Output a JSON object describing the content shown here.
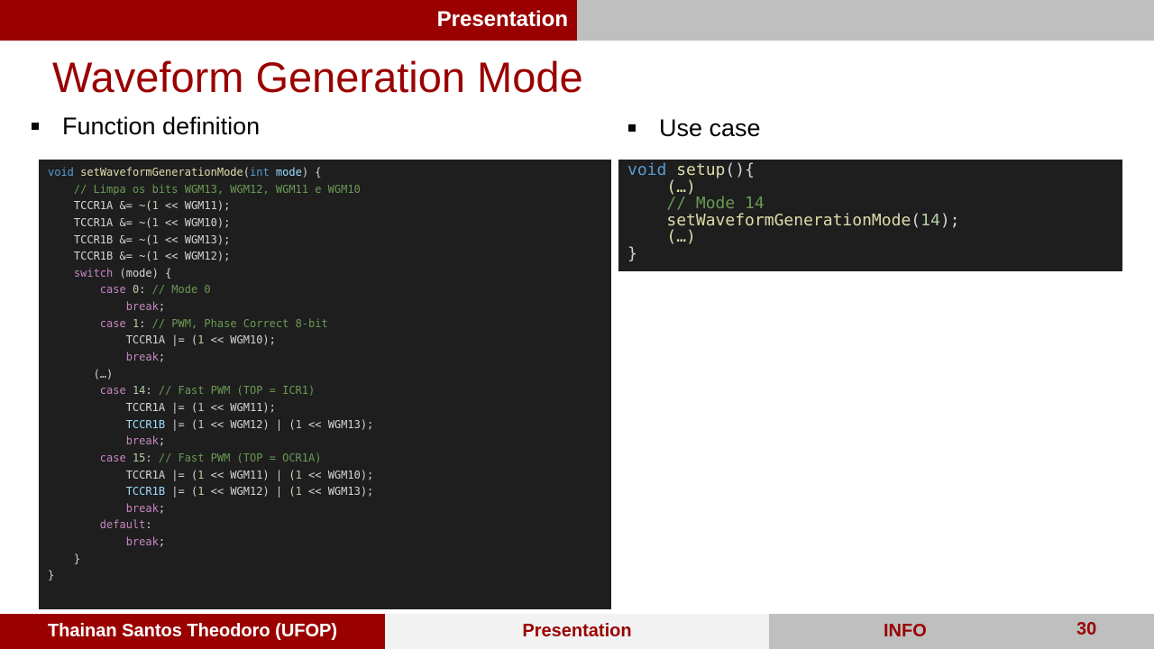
{
  "header": {
    "section_label": "Presentation"
  },
  "slide": {
    "title": "Waveform Generation Mode",
    "left_bullet": "Function definition",
    "right_bullet": "Use case"
  },
  "code_left": [
    [
      [
        "kw",
        "void"
      ],
      [
        "id",
        " "
      ],
      [
        "fn",
        "setWaveformGenerationMode"
      ],
      [
        "id",
        "("
      ],
      [
        "kw",
        "int"
      ],
      [
        "id",
        " "
      ],
      [
        "var",
        "mode"
      ],
      [
        "id",
        ") {"
      ]
    ],
    [
      [
        "id",
        "    "
      ],
      [
        "cm",
        "// Limpa os bits WGM13, WGM12, WGM11 e WGM10"
      ]
    ],
    [
      [
        "id",
        "    TCCR1A &= ~("
      ],
      [
        "num",
        "1"
      ],
      [
        "id",
        " << WGM11);"
      ]
    ],
    [
      [
        "id",
        "    TCCR1A &= ~("
      ],
      [
        "num",
        "1"
      ],
      [
        "id",
        " << WGM10);"
      ]
    ],
    [
      [
        "id",
        "    TCCR1B &= ~("
      ],
      [
        "num",
        "1"
      ],
      [
        "id",
        " << WGM13);"
      ]
    ],
    [
      [
        "id",
        "    TCCR1B &= ~("
      ],
      [
        "num",
        "1"
      ],
      [
        "id",
        " << WGM12);"
      ]
    ],
    [
      [
        "id",
        "    "
      ],
      [
        "ctl",
        "switch"
      ],
      [
        "id",
        " (mode) {"
      ]
    ],
    [
      [
        "id",
        "        "
      ],
      [
        "ctl",
        "case"
      ],
      [
        "id",
        " "
      ],
      [
        "num",
        "0"
      ],
      [
        "id",
        ": "
      ],
      [
        "cm",
        "// Mode 0"
      ]
    ],
    [
      [
        "id",
        "            "
      ],
      [
        "ctl",
        "break"
      ],
      [
        "id",
        ";"
      ]
    ],
    [
      [
        "id",
        "        "
      ],
      [
        "ctl",
        "case"
      ],
      [
        "id",
        " "
      ],
      [
        "num",
        "1"
      ],
      [
        "id",
        ": "
      ],
      [
        "cm",
        "// PWM, Phase Correct 8-bit"
      ]
    ],
    [
      [
        "id",
        "            TCCR1A |= ("
      ],
      [
        "num",
        "1"
      ],
      [
        "id",
        " << WGM10);"
      ]
    ],
    [
      [
        "id",
        "            "
      ],
      [
        "ctl",
        "break"
      ],
      [
        "id",
        ";"
      ]
    ],
    [
      [
        "id",
        "       (…)"
      ]
    ],
    [
      [
        "id",
        "        "
      ],
      [
        "ctl",
        "case"
      ],
      [
        "id",
        " "
      ],
      [
        "num",
        "14"
      ],
      [
        "id",
        ": "
      ],
      [
        "cm",
        "// Fast PWM (TOP = ICR1)"
      ]
    ],
    [
      [
        "id",
        "            TCCR1A |= ("
      ],
      [
        "num",
        "1"
      ],
      [
        "id",
        " << WGM11);"
      ]
    ],
    [
      [
        "id",
        "            "
      ],
      [
        "var",
        "TCCR1B"
      ],
      [
        "id",
        " |= ("
      ],
      [
        "num",
        "1"
      ],
      [
        "id",
        " << WGM12) | ("
      ],
      [
        "num",
        "1"
      ],
      [
        "id",
        " << WGM13);"
      ]
    ],
    [
      [
        "id",
        "            "
      ],
      [
        "ctl",
        "break"
      ],
      [
        "id",
        ";"
      ]
    ],
    [
      [
        "id",
        "        "
      ],
      [
        "ctl",
        "case"
      ],
      [
        "id",
        " "
      ],
      [
        "num",
        "15"
      ],
      [
        "id",
        ": "
      ],
      [
        "cm",
        "// Fast PWM (TOP = OCR1A)"
      ]
    ],
    [
      [
        "id",
        "            TCCR1A |= ("
      ],
      [
        "num",
        "1"
      ],
      [
        "id",
        " << WGM11) | ("
      ],
      [
        "num",
        "1"
      ],
      [
        "id",
        " << WGM10);"
      ]
    ],
    [
      [
        "id",
        "            "
      ],
      [
        "var",
        "TCCR1B"
      ],
      [
        "id",
        " |= ("
      ],
      [
        "num",
        "1"
      ],
      [
        "id",
        " << WGM12) | ("
      ],
      [
        "num",
        "1"
      ],
      [
        "id",
        " << WGM13);"
      ]
    ],
    [
      [
        "id",
        "            "
      ],
      [
        "ctl",
        "break"
      ],
      [
        "id",
        ";"
      ]
    ],
    [
      [
        "id",
        "        "
      ],
      [
        "ctl",
        "default"
      ],
      [
        "id",
        ":"
      ]
    ],
    [
      [
        "id",
        "            "
      ],
      [
        "ctl",
        "break"
      ],
      [
        "id",
        ";"
      ]
    ],
    [
      [
        "id",
        "    }"
      ]
    ],
    [
      [
        "id",
        "}"
      ]
    ]
  ],
  "code_right": [
    [
      [
        "kw",
        "void"
      ],
      [
        "id",
        " "
      ],
      [
        "fn",
        "setup"
      ],
      [
        "id",
        "(){"
      ]
    ],
    [
      [
        "id",
        "    "
      ],
      [
        "fn",
        "(…)"
      ]
    ],
    [
      [
        "id",
        "    "
      ],
      [
        "cm",
        "// Mode 14"
      ]
    ],
    [
      [
        "id",
        "    "
      ],
      [
        "fn",
        "setWaveformGenerationMode"
      ],
      [
        "id",
        "("
      ],
      [
        "num",
        "14"
      ],
      [
        "id",
        ");"
      ]
    ],
    [
      [
        "id",
        "    "
      ],
      [
        "fn",
        "(…)"
      ]
    ],
    [
      [
        "id",
        "}"
      ]
    ]
  ],
  "footer": {
    "author": "Thainan Santos Theodoro (UFOP)",
    "center_label": "Presentation",
    "info_label": "INFO",
    "page_number": "30"
  },
  "colors": {
    "brand_red": "#9a0000",
    "gray_bar": "#bfbfbf",
    "code_bg": "#1e1e1e"
  }
}
